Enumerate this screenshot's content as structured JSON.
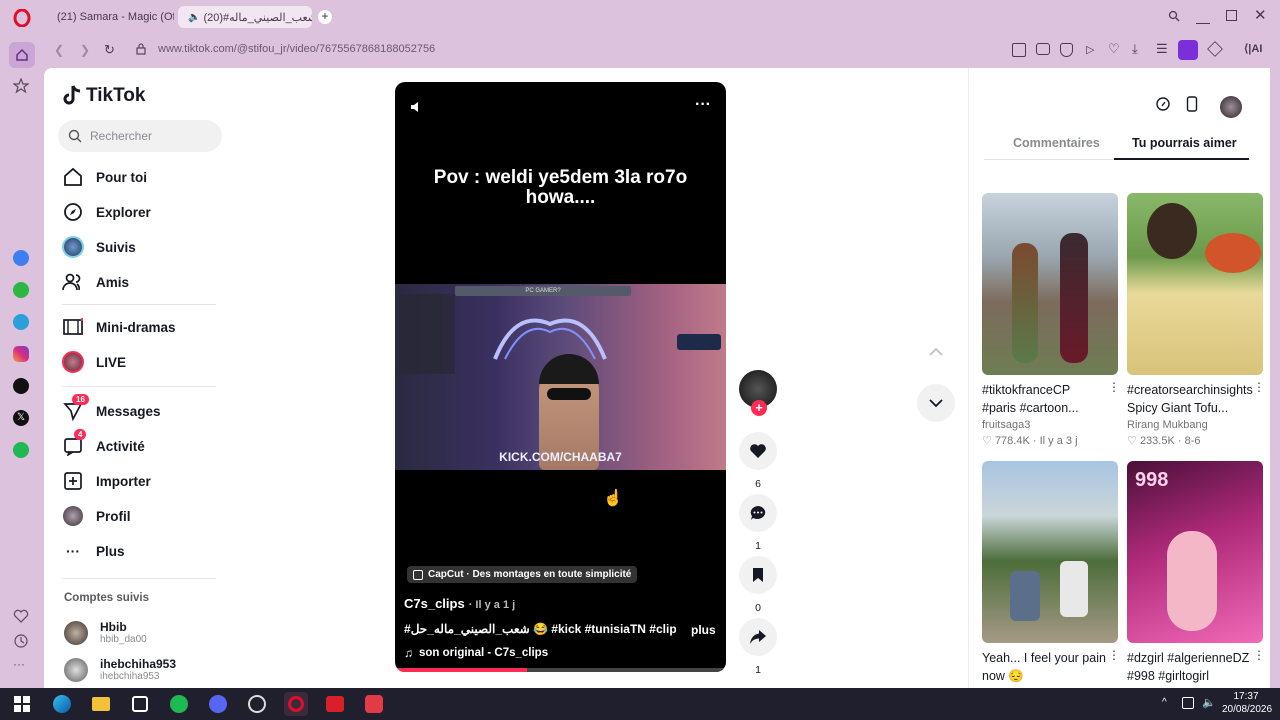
{
  "browser": {
    "tabs": [
      {
        "title": "(21) Samara - Magic (Offi"
      },
      {
        "title": "شعب_الصيني_ماله#(20)"
      }
    ],
    "url": "www.tiktok.com/@stifou_jr/video/7675567868188052756",
    "ai_label": "AI"
  },
  "sidebar": {
    "logo": "TikTok",
    "search_placeholder": "Rechercher",
    "nav": [
      {
        "label": "Pour toi",
        "icon": "home-icon"
      },
      {
        "label": "Explorer",
        "icon": "compass-icon"
      },
      {
        "label": "Suivis",
        "icon": "avatar"
      },
      {
        "label": "Amis",
        "icon": "friends-icon"
      },
      {
        "label": "Mini-dramas",
        "icon": "film-icon"
      },
      {
        "label": "LIVE",
        "icon": "live-avatar"
      },
      {
        "label": "Messages",
        "icon": "send-icon",
        "badge": "16"
      },
      {
        "label": "Activité",
        "icon": "inbox-icon",
        "badge": "4"
      },
      {
        "label": "Importer",
        "icon": "plus-box-icon"
      },
      {
        "label": "Profil",
        "icon": "profile-avatar"
      },
      {
        "label": "Plus",
        "icon": "more-icon"
      }
    ],
    "following_title": "Comptes suivis",
    "following": [
      {
        "name": "Hbib",
        "handle": "hbib_da00"
      },
      {
        "name": "ihebchiha953",
        "handle": "ihebchiha953"
      }
    ]
  },
  "video": {
    "caption": "Pov : weldi ye5dem 3la ro7o howa....",
    "stream_overlay": "KICK.COM/CHAABA7",
    "stream_header": "PC GAMER?",
    "capcut_label": "CapCut · Des montages en toute simplicité",
    "author": "C7s_clips",
    "time": "· Il y a 1 j",
    "description": "#شعب_الصيني_ماله_حل 😂 #kick #tunisiaTN #clips ...",
    "more": "plus",
    "sound": "son original - C7s_clips",
    "progress": 0.4
  },
  "actions": {
    "likes": "6",
    "comments": "1",
    "saves": "0",
    "shares": "1"
  },
  "right_panel": {
    "tabs": [
      "Commentaires",
      "Tu pourrais aimer"
    ],
    "active_tab": "Tu pourrais aimer",
    "cards": [
      {
        "title": "#tiktokfranceCP #paris #cartoon...",
        "author": "fruitsaga3",
        "views": "778.4K",
        "age": "Il y a 3 j"
      },
      {
        "title": "#creatorsearchinsights Spicy Giant Tofu...",
        "author": "Rirang Mukbang",
        "views": "233.5K",
        "age": "8-6"
      },
      {
        "title": "Yeah... I feel your pain now 😔",
        "author": "",
        "views": "",
        "age": ""
      },
      {
        "title": "#dzgirl #algerienneDZ #998 #girltogirl",
        "author": "",
        "views": "",
        "age": ""
      }
    ],
    "card4_badge": "998"
  },
  "taskbar": {
    "time": "17:37",
    "date": "20/08/2026"
  },
  "colors": {
    "browser_bg": "#ddc2dd",
    "tiktok_red": "#fe2c55",
    "text": "#161823"
  }
}
